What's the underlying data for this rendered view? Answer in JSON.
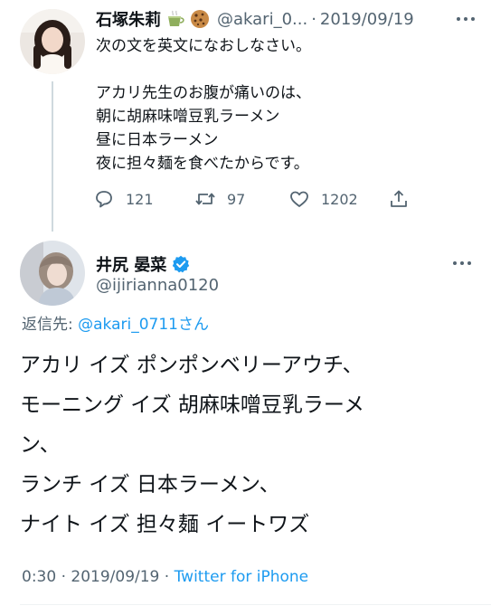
{
  "colors": {
    "text_primary": "#0f1419",
    "text_secondary": "#536471",
    "link": "#1d9bf0",
    "thread_line": "#cfd9de"
  },
  "parent_tweet": {
    "display_name": "石塚朱莉",
    "emojis": [
      "tea-icon",
      "cookie-icon"
    ],
    "handle": "@akari_0...",
    "separator": "·",
    "date": "2019/09/19",
    "text_lines": [
      "次の文を英文になおしなさい。",
      "",
      "アカリ先生のお腹が痛いのは、",
      "朝に胡麻味噌豆乳ラーメン",
      "昼に日本ラーメン",
      "夜に担々麺を食べたからです。"
    ],
    "actions": {
      "reply_count": "121",
      "retweet_count": "97",
      "like_count": "1202",
      "icons": [
        "reply-icon",
        "retweet-icon",
        "like-icon",
        "share-icon"
      ]
    }
  },
  "reply_tweet": {
    "display_name": "井尻 晏菜",
    "verified": true,
    "handle": "@ijirianna0120",
    "replying_to_label": "返信先: ",
    "replying_to_mention": "@akari_0711さん",
    "text_lines": [
      "アカリ イズ ポンポンベリーアウチ、",
      "モーニング イズ 胡麻味噌豆乳ラーメ",
      "ン、",
      "ランチ イズ 日本ラーメン、",
      "ナイト イズ 担々麺 イートワズ"
    ],
    "time": "0:30 · 2019/09/19 · ",
    "source": "Twitter for iPhone"
  }
}
